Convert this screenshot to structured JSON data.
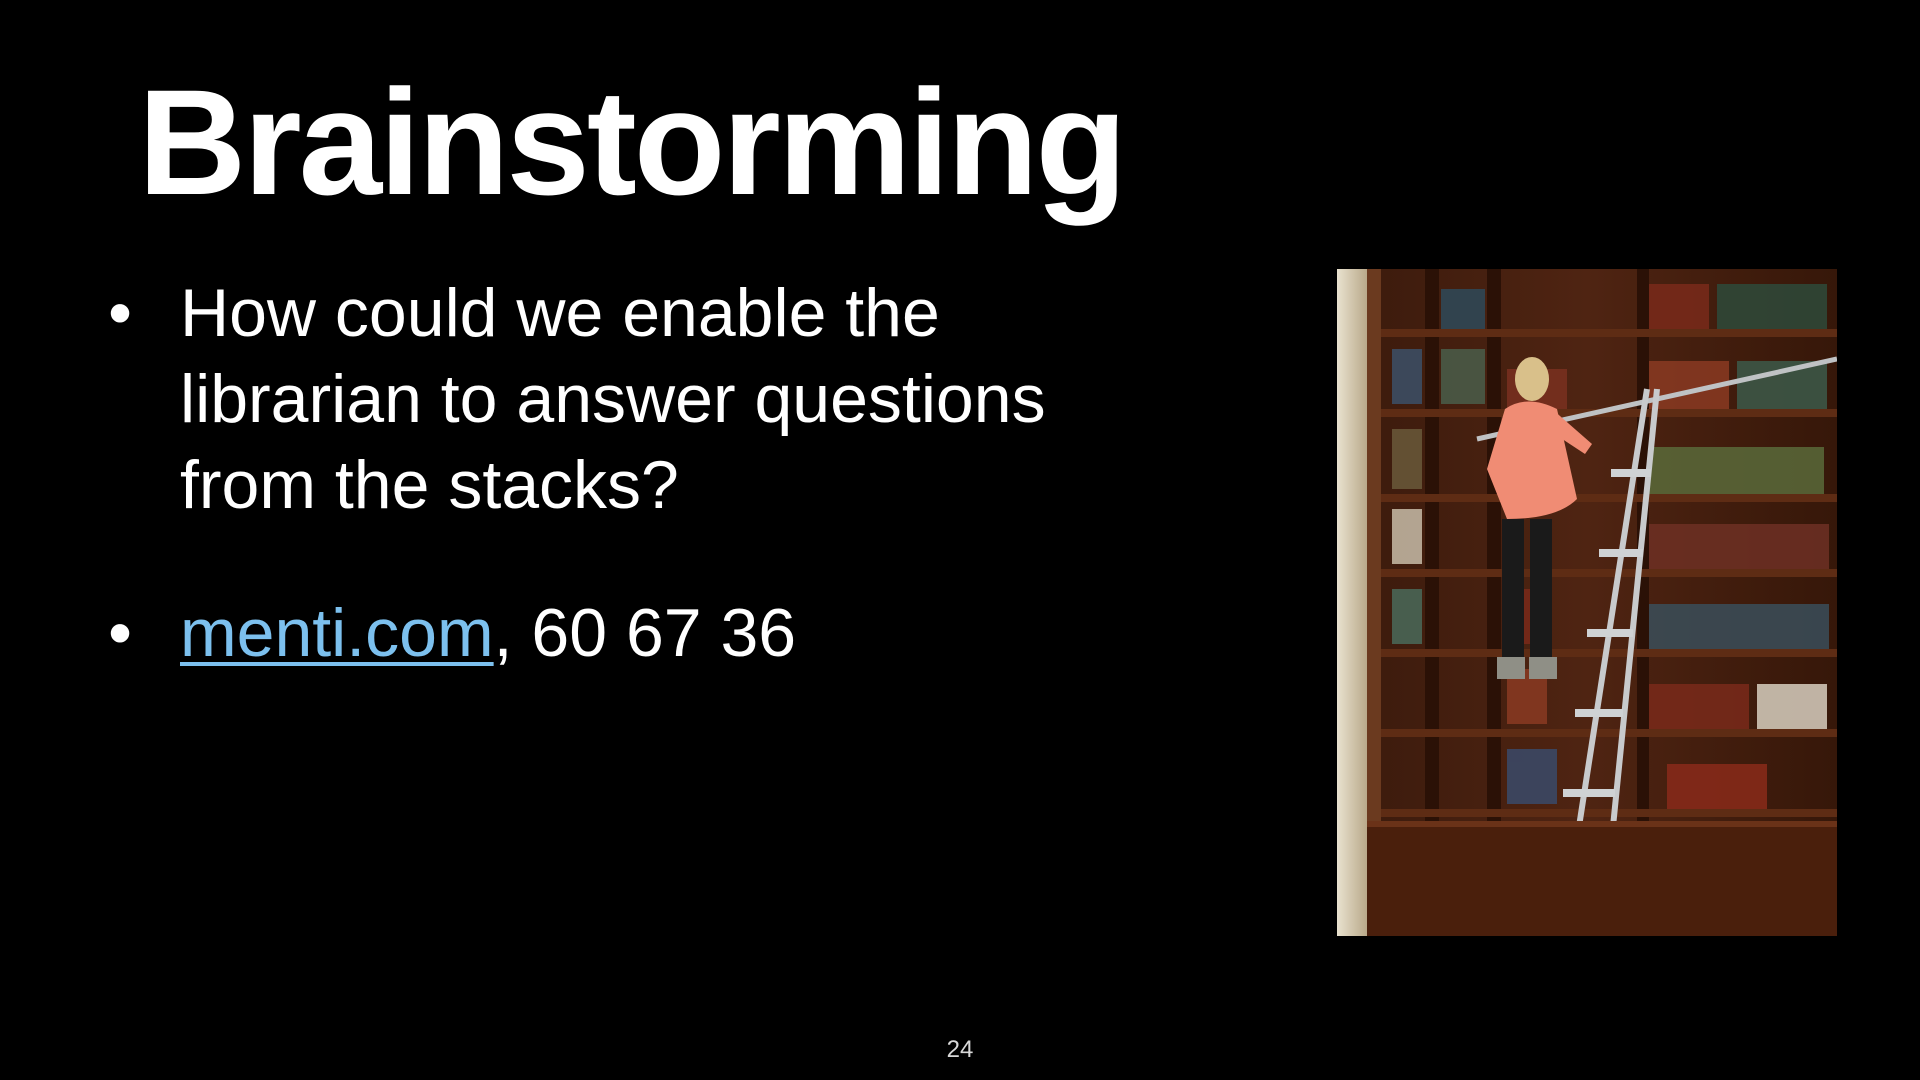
{
  "slide": {
    "title": "Brainstorming",
    "bullets": [
      {
        "text": "How could we enable the librarian to answer questions from the stacks?"
      },
      {
        "link_text": "menti.com",
        "suffix": ", 60 67 36"
      }
    ],
    "bullet_glyph": "•",
    "page_number": "24",
    "image": {
      "subject": "librarian-on-ladder-at-bookshelf"
    },
    "colors": {
      "background": "#000000",
      "text": "#ffffff",
      "link": "#7cc0ee"
    }
  }
}
